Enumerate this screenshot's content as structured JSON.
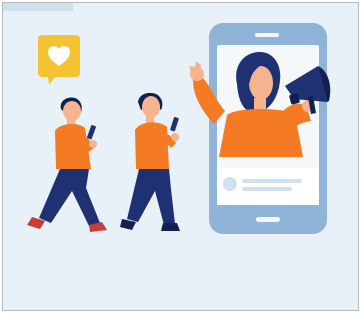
{
  "scene": {
    "colors": {
      "background": "#e8f1f7",
      "phone_frame": "#8fb4d8",
      "phone_screen": "#f5f8fb",
      "orange": "#f47a24",
      "navy": "#203173",
      "dark_navy": "#132052",
      "skin": "#f6b48e",
      "heart_bubble": "#f3c331"
    },
    "icons": {
      "heart": "heart-icon",
      "megaphone": "megaphone-icon",
      "smartphone": "smartphone-icon"
    }
  }
}
